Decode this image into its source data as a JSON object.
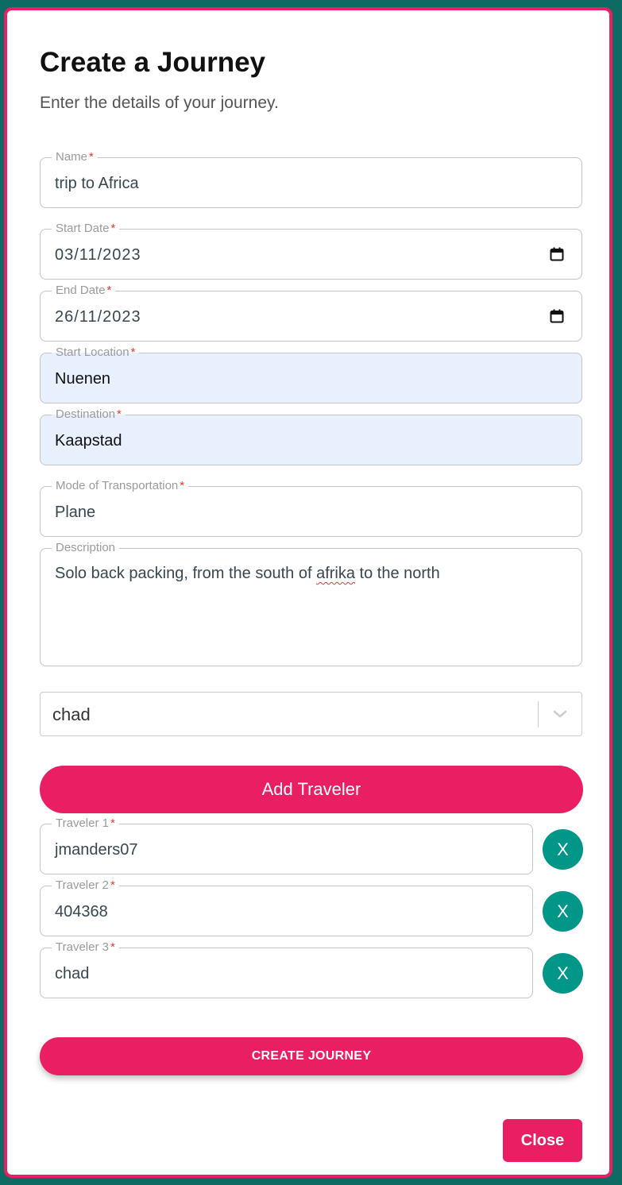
{
  "dialog": {
    "title": "Create a Journey",
    "subtitle": "Enter the details of your journey."
  },
  "form": {
    "name": {
      "label": "Name",
      "value": "trip to Africa"
    },
    "start_date": {
      "label": "Start Date",
      "value": "03/11/2023"
    },
    "end_date": {
      "label": "End Date",
      "value": "26/11/2023"
    },
    "start_location": {
      "label": "Start Location",
      "value": "Nuenen"
    },
    "destination": {
      "label": "Destination",
      "value": "Kaapstad"
    },
    "transportation": {
      "label": "Mode of Transportation",
      "value": "Plane"
    },
    "description": {
      "label": "Description",
      "value_before": "Solo back packing, from the south of ",
      "value_misspelled": "afrika",
      "value_after": " to the north"
    },
    "required_mark": "*"
  },
  "traveler_select": {
    "selected": "chad"
  },
  "buttons": {
    "add_traveler": "Add Traveler",
    "create_journey": "CREATE JOURNEY",
    "close": "Close"
  },
  "travelers": [
    {
      "label": "Traveler 1",
      "value": "jmanders07",
      "remove_label": "X"
    },
    {
      "label": "Traveler 2",
      "value": "404368",
      "remove_label": "X"
    },
    {
      "label": "Traveler 3",
      "value": "chad",
      "remove_label": "X"
    }
  ],
  "colors": {
    "accent": "#e91e63",
    "remove_button": "#009688",
    "backdrop": "#0d6b63",
    "autofill_background": "#e8f0fe",
    "required": "#e53935"
  },
  "icons": {
    "date_picker": "calendar-icon",
    "select_toggle": "chevron-down-icon"
  }
}
